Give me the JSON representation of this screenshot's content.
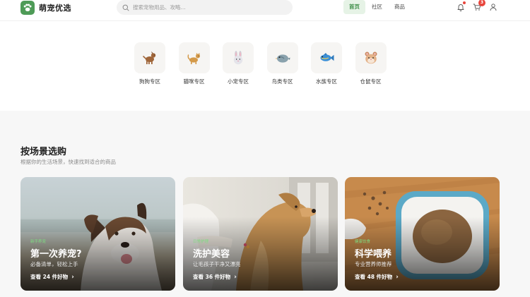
{
  "header": {
    "brand": "萌宠优选",
    "search": {
      "placeholder": "搜索宠物用品、攻略..."
    },
    "nav": [
      {
        "label": "首页",
        "active": true
      },
      {
        "label": "社区",
        "active": false
      },
      {
        "label": "商品",
        "active": false
      }
    ],
    "icons": {
      "notification": "bell-icon",
      "cart": "cart-icon",
      "cart_count": "3",
      "user": "user-icon"
    }
  },
  "categories": [
    {
      "label": "狗狗专区",
      "emoji": "🐕"
    },
    {
      "label": "猫咪专区",
      "emoji": "🐈"
    },
    {
      "label": "小宠专区",
      "emoji": "🐰"
    },
    {
      "label": "鸟类专区",
      "emoji": "🐦"
    },
    {
      "label": "水族专区",
      "emoji": "🐟"
    },
    {
      "label": "仓鼠专区",
      "emoji": "🐹"
    }
  ],
  "scenes": {
    "title": "按场景选购",
    "subtitle": "根据你的生活场景，快速找到适合的商品",
    "cards": [
      {
        "tag": "新手养宠",
        "title": "第一次养宠?",
        "desc": "必备清单，轻松上手",
        "link": "查看 24 件好物"
      },
      {
        "tag": "日常护理",
        "title": "洗护美容",
        "desc": "让毛孩子干净又漂亮",
        "link": "查看 36 件好物"
      },
      {
        "tag": "健康饮食",
        "title": "科学喂养",
        "desc": "专业营养师推荐",
        "link": "查看 48 件好物"
      }
    ]
  },
  "colors": {
    "brand_green": "#4e9b57",
    "nav_active_bg": "#e6f3e6",
    "badge_red": "#e8453c"
  }
}
